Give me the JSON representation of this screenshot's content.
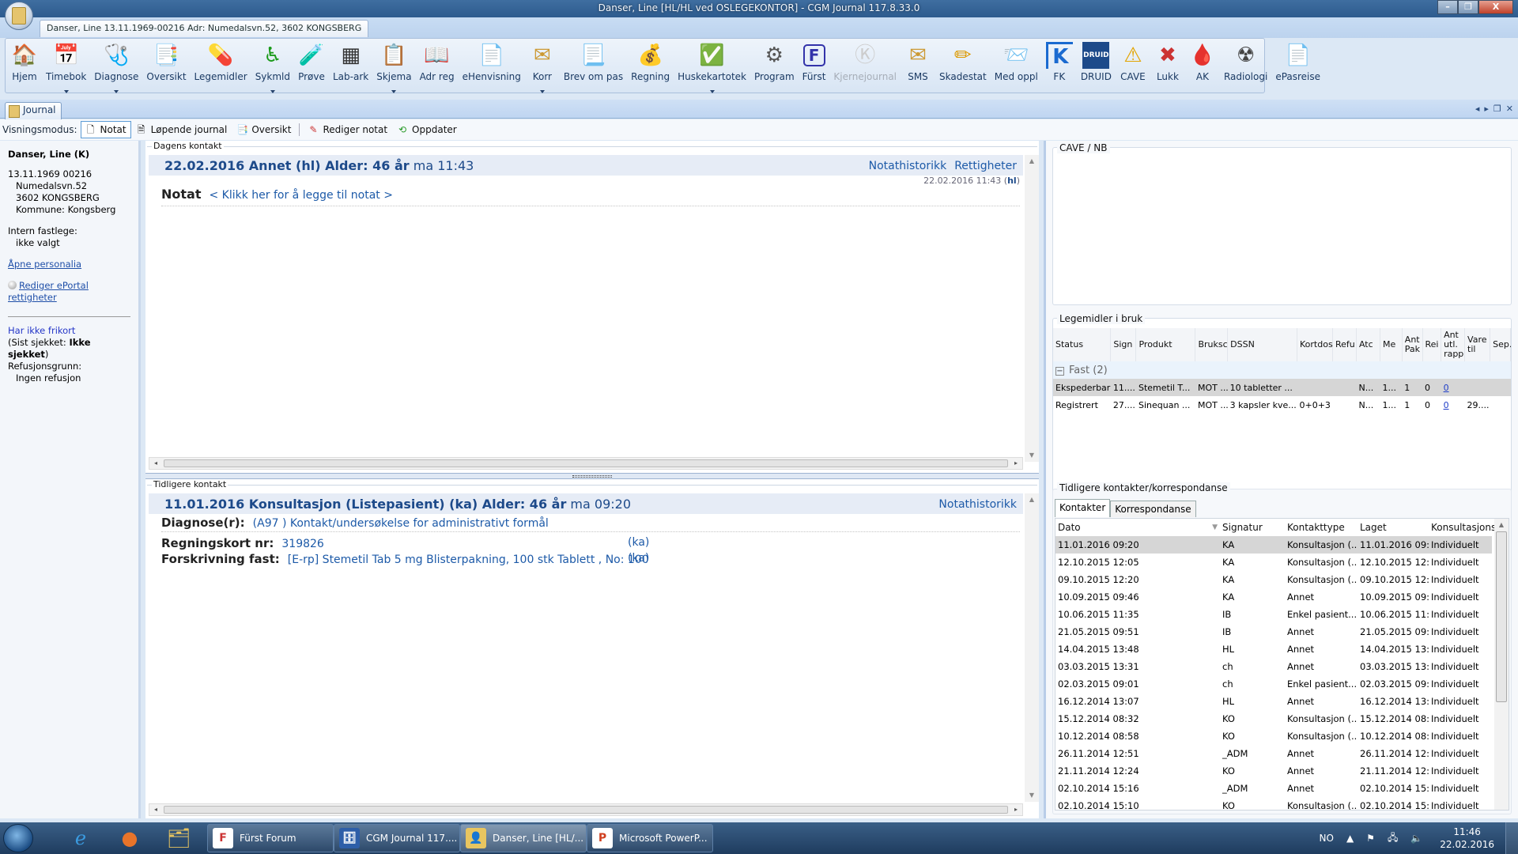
{
  "window": {
    "title": "Danser, Line [HL/HL ved OSLEGEKONTOR] - CGM Journal 117.8.33.0",
    "patient_tab": "Danser, Line 13.11.1969-00216 Adr: Numedalsvn.52, 3602 KONGSBERG",
    "controls": {
      "minimize": "–",
      "maximize": "❐",
      "close": "X"
    }
  },
  "ribbon": {
    "buttons": [
      {
        "label": "Hjem",
        "icon": "home-icon",
        "glyph": "🏠",
        "dropdown": false,
        "disabled": false
      },
      {
        "label": "Timebok",
        "icon": "calendar-icon",
        "glyph": "📅",
        "dropdown": true,
        "disabled": false
      },
      {
        "label": "Diagnose",
        "icon": "stethoscope-icon",
        "glyph": "🩺",
        "dropdown": true,
        "disabled": false
      },
      {
        "label": "Oversikt",
        "icon": "overview-icon",
        "glyph": "📑",
        "dropdown": false,
        "disabled": false
      },
      {
        "label": "Legemidler",
        "icon": "pill-icon",
        "glyph": "💊",
        "dropdown": false,
        "disabled": false
      },
      {
        "label": "Sykmld",
        "icon": "wheelchair-icon",
        "glyph": "♿",
        "dropdown": true,
        "disabled": false
      },
      {
        "label": "Prøve",
        "icon": "test-tube-icon",
        "glyph": "🧪",
        "dropdown": false,
        "disabled": false
      },
      {
        "label": "Lab-ark",
        "icon": "lab-sheet-icon",
        "glyph": "▦",
        "dropdown": false,
        "disabled": false
      },
      {
        "label": "Skjema",
        "icon": "form-icon",
        "glyph": "📋",
        "dropdown": true,
        "disabled": false
      },
      {
        "label": "Adr reg",
        "icon": "address-book-icon",
        "glyph": "📖",
        "dropdown": false,
        "disabled": false
      },
      {
        "label": "eHenvisning",
        "icon": "referral-icon",
        "glyph": "📄",
        "dropdown": false,
        "disabled": false
      },
      {
        "label": "Korr",
        "icon": "envelope-icon",
        "glyph": "✉",
        "dropdown": true,
        "disabled": false
      },
      {
        "label": "Brev om pas",
        "icon": "letter-icon",
        "glyph": "📃",
        "dropdown": false,
        "disabled": false
      },
      {
        "label": "Regning",
        "icon": "coins-icon",
        "glyph": "💰",
        "dropdown": false,
        "disabled": false
      },
      {
        "label": "Huskekartotek",
        "icon": "checklist-icon",
        "glyph": "✅",
        "dropdown": true,
        "disabled": false
      },
      {
        "label": "Program",
        "icon": "gear-icon",
        "glyph": "⚙",
        "dropdown": false,
        "disabled": false
      },
      {
        "label": "Fürst",
        "icon": "furst-icon",
        "glyph": "F",
        "dropdown": false,
        "disabled": false
      },
      {
        "label": "Kjernejournal",
        "icon": "kjernejournal-icon",
        "glyph": "Ⓚ",
        "dropdown": false,
        "disabled": true
      },
      {
        "label": "SMS",
        "icon": "sms-icon",
        "glyph": "✉",
        "dropdown": false,
        "disabled": false
      },
      {
        "label": "Skadestat",
        "icon": "crutch-icon",
        "glyph": "✏",
        "dropdown": false,
        "disabled": false
      },
      {
        "label": "Med oppl",
        "icon": "med-info-icon",
        "glyph": "📨",
        "dropdown": false,
        "disabled": false
      },
      {
        "label": "FK",
        "icon": "fk-icon",
        "glyph": "K",
        "dropdown": false,
        "disabled": false
      },
      {
        "label": "DRUID",
        "icon": "druid-icon",
        "glyph": "DRUID",
        "dropdown": false,
        "disabled": false
      },
      {
        "label": "CAVE",
        "icon": "warning-icon",
        "glyph": "⚠",
        "dropdown": false,
        "disabled": false
      },
      {
        "label": "Lukk",
        "icon": "close-x-icon",
        "glyph": "✖",
        "dropdown": false,
        "disabled": false
      },
      {
        "label": "AK",
        "icon": "blood-drop-icon",
        "glyph": "🩸",
        "dropdown": false,
        "disabled": false
      },
      {
        "label": "Radiologi",
        "icon": "radiology-icon",
        "glyph": "☢",
        "dropdown": false,
        "disabled": false
      },
      {
        "label": "ePasreise",
        "icon": "epasreise-icon",
        "glyph": "📄",
        "dropdown": false,
        "disabled": false
      }
    ]
  },
  "tabs": {
    "journal": "Journal"
  },
  "modebar": {
    "label": "Visningsmodus:",
    "buttons": [
      {
        "label": "Notat",
        "active": true
      },
      {
        "label": "Løpende journal",
        "active": false
      },
      {
        "label": "Oversikt",
        "active": false
      },
      {
        "label": "Rediger notat",
        "active": false
      },
      {
        "label": "Oppdater",
        "active": false
      }
    ]
  },
  "sidebar": {
    "name": "Danser, Line (K)",
    "birth": "13.11.1969 00216",
    "address": "Numedalsvn.52",
    "postal": "3602 KONGSBERG",
    "municipality": "Kommune: Kongsberg",
    "gp_label": "Intern fastlege:",
    "gp_value": "ikke valgt",
    "open_personalia": "Åpne personalia",
    "eportal": "Rediger ePortal rettigheter",
    "frikort": "Har ikke frikort",
    "checked_prefix": "(Sist sjekket: ",
    "checked_value": "Ikke sjekket",
    "checked_suffix": ")",
    "refund_label": "Refusjonsgrunn:",
    "refund_value": "Ingen refusjon"
  },
  "today": {
    "group_label": "Dagens kontakt",
    "title_bold": "22.02.2016 Annet (hl)  Alder: 46 år",
    "title_time": " ma 11:43",
    "links": [
      "Notathistorikk",
      "Rettigheter"
    ],
    "stamp_date": "22.02.2016 11:43 (",
    "stamp_sig": "hl",
    "stamp_end": ")",
    "notat_label": "Notat",
    "notat_add": "< Klikk her for å legge til notat >"
  },
  "previous": {
    "group_label": "Tidligere kontakt",
    "title_bold": "11.01.2016 Konsultasjon (Listepasient) (ka)  Alder: 46 år",
    "title_time": " ma 09:20",
    "link": "Notathistorikk",
    "diagnose_label": "Diagnose(r):",
    "diagnose_value": "(A97 ) Kontakt/undersøkelse for administrativt formål",
    "regning_label": "Regningskort nr:",
    "regning_value": "319826",
    "regning_sig": "(ka)",
    "forskrivning_label": "Forskrivning fast:",
    "forskrivning_value": "[E-rp] Stemetil Tab 5 mg Blisterpakning, 100 stk Tablett , No: 100",
    "forskrivning_sig": "(ka)"
  },
  "cave": {
    "label": "CAVE / NB"
  },
  "medications": {
    "label": "Legemidler i bruk",
    "columns": [
      "Status",
      "Sign",
      "Produkt",
      "Bruksc",
      "DSSN",
      "Kortdos",
      "Refu",
      "Atc",
      "Me",
      "Ant Pak",
      "Rei",
      "Ant utl. rapp",
      "Vare til",
      "Sep."
    ],
    "group": "Fast (2)",
    "rows": [
      {
        "cells": [
          "Ekspederbar",
          "11....",
          "Stemetil T...",
          "MOT ...",
          "10 tabletter ...",
          "",
          "",
          "N...",
          "1...",
          "1",
          "0",
          "0",
          "",
          ""
        ],
        "selected": true
      },
      {
        "cells": [
          "Registrert",
          "27....",
          "Sinequan ...",
          "MOT ...",
          "3 kapsler kve...",
          "0+0+3",
          "",
          "N...",
          "1...",
          "1",
          "0",
          "0",
          "29....",
          ""
        ],
        "selected": false
      }
    ]
  },
  "contacts": {
    "label": "Tidligere kontakter/korrespondanse",
    "tabs": [
      "Kontakter",
      "Korrespondanse"
    ],
    "columns": [
      "Dato",
      "Signatur",
      "Kontakttype",
      "Laget",
      "Konsultasjonst"
    ],
    "rows": [
      [
        "11.01.2016 09:20",
        "KA",
        "Konsultasjon (...",
        "11.01.2016 09:...",
        "Individuelt"
      ],
      [
        "12.10.2015 12:05",
        "KA",
        "Konsultasjon (...",
        "12.10.2015 12:...",
        "Individuelt"
      ],
      [
        "09.10.2015 12:20",
        "KA",
        "Konsultasjon (...",
        "09.10.2015 12:...",
        "Individuelt"
      ],
      [
        "10.09.2015 09:46",
        "KA",
        "Annet",
        "10.09.2015 09:...",
        "Individuelt"
      ],
      [
        "10.06.2015 11:35",
        "IB",
        "Enkel pasient...",
        "10.06.2015 11:...",
        "Individuelt"
      ],
      [
        "21.05.2015 09:51",
        "IB",
        "Annet",
        "21.05.2015 09:...",
        "Individuelt"
      ],
      [
        "14.04.2015 13:48",
        "HL",
        "Annet",
        "14.04.2015 13:...",
        "Individuelt"
      ],
      [
        "03.03.2015 13:31",
        "ch",
        "Annet",
        "03.03.2015 13:...",
        "Individuelt"
      ],
      [
        "02.03.2015 09:01",
        "ch",
        "Enkel pasient...",
        "02.03.2015 09:...",
        "Individuelt"
      ],
      [
        "16.12.2014 13:07",
        "HL",
        "Annet",
        "16.12.2014 13:...",
        "Individuelt"
      ],
      [
        "15.12.2014 08:32",
        "KO",
        "Konsultasjon (...",
        "15.12.2014 08:...",
        "Individuelt"
      ],
      [
        "10.12.2014 08:58",
        "KO",
        "Konsultasjon (...",
        "10.12.2014 08:...",
        "Individuelt"
      ],
      [
        "26.11.2014 12:51",
        "_ADM",
        "Annet",
        "26.11.2014 12:...",
        "Individuelt"
      ],
      [
        "21.11.2014 12:24",
        "KO",
        "Annet",
        "21.11.2014 12:...",
        "Individuelt"
      ],
      [
        "02.10.2014 15:16",
        "_ADM",
        "Annet",
        "02.10.2014 15:...",
        "Individuelt"
      ],
      [
        "02.10.2014 15:10",
        "KO",
        "Konsultasjon (...",
        "02.10.2014 15:...",
        "Individuelt"
      ]
    ]
  },
  "taskbar": {
    "tasks": [
      {
        "label": "Fürst Forum",
        "icon": "F",
        "active": false
      },
      {
        "label": "CGM Journal 117....",
        "icon": "🗄",
        "active": false
      },
      {
        "label": "Danser, Line [HL/...",
        "icon": "👤",
        "active": true
      },
      {
        "label": "Microsoft PowerP...",
        "icon": "P",
        "active": false
      }
    ],
    "language": "NO",
    "time": "11:46",
    "date": "22.02.2016"
  }
}
